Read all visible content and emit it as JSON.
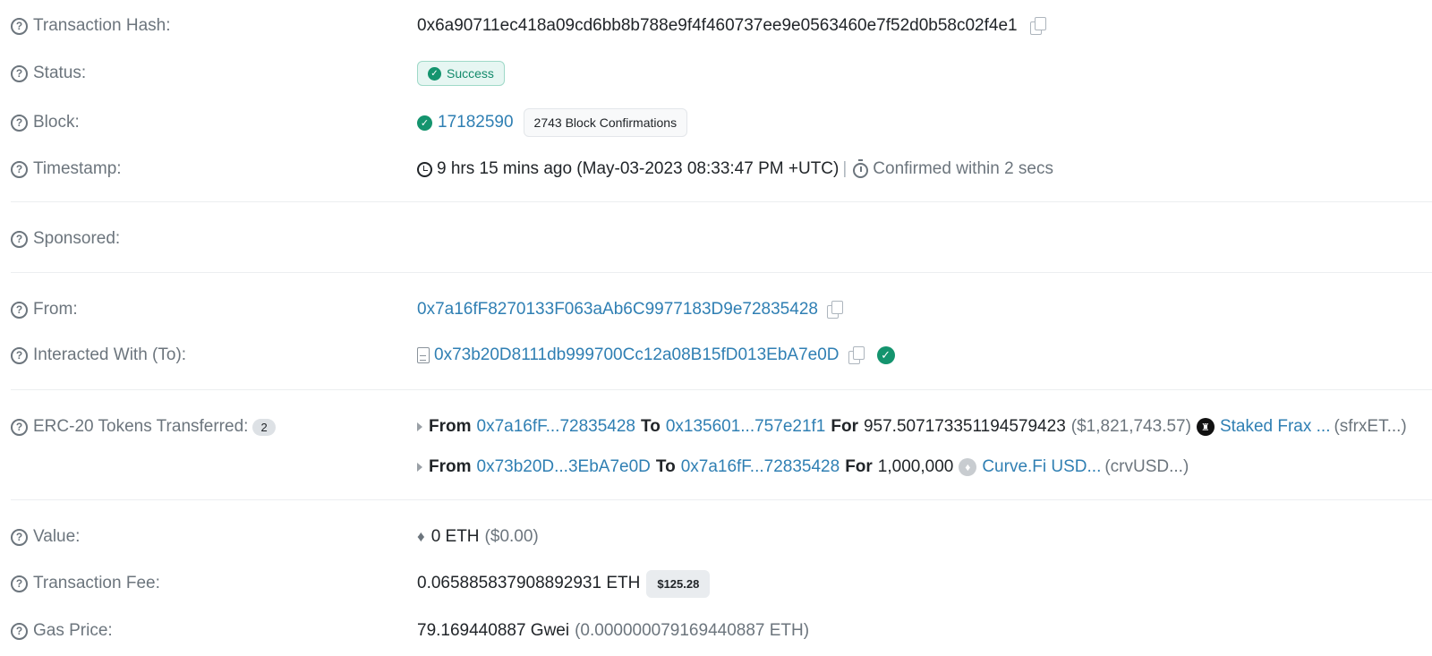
{
  "fields": {
    "tx_hash": {
      "label": "Transaction Hash:",
      "value": "0x6a90711ec418a09cd6bb8b788e9f4f460737ee9e0563460e7f52d0b58c02f4e1"
    },
    "status": {
      "label": "Status:",
      "value": "Success"
    },
    "block": {
      "label": "Block:",
      "number": "17182590",
      "confirmations": "2743 Block Confirmations"
    },
    "timestamp": {
      "label": "Timestamp:",
      "ago": "9 hrs 15 mins ago (May-03-2023 08:33:47 PM +UTC)",
      "separator": "|",
      "confirmed": "Confirmed within 2 secs"
    },
    "sponsored": {
      "label": "Sponsored:"
    },
    "from": {
      "label": "From:",
      "address": "0x7a16fF8270133F063aAb6C9977183D9e72835428"
    },
    "to": {
      "label": "Interacted With (To):",
      "address": "0x73b20D8111db999700Cc12a08B15fD013EbA7e0D"
    },
    "erc20": {
      "label": "ERC-20 Tokens Transferred:",
      "count": "2",
      "transfers": [
        {
          "from_word": "From",
          "from": "0x7a16fF...72835428",
          "to_word": "To",
          "to": "0x135601...757e21f1",
          "for_word": "For",
          "amount": "957.507173351194579423",
          "usd": "($1,821,743.57)",
          "token_name": "Staked Frax ...",
          "token_symbol": "(sfrxET...)",
          "token_icon": "sfrxeth-token-icon"
        },
        {
          "from_word": "From",
          "from": "0x73b20D...3EbA7e0D",
          "to_word": "To",
          "to": "0x7a16fF...72835428",
          "for_word": "For",
          "amount": "1,000,000",
          "usd": "",
          "token_name": "Curve.Fi USD...",
          "token_symbol": "(crvUSD...)",
          "token_icon": "crvusd-token-icon"
        }
      ]
    },
    "value": {
      "label": "Value:",
      "amount": "0 ETH",
      "usd": "($0.00)"
    },
    "fee": {
      "label": "Transaction Fee:",
      "amount": "0.065885837908892931 ETH",
      "usd": "$125.28"
    },
    "gas_price": {
      "label": "Gas Price:",
      "gwei": "79.169440887 Gwei",
      "eth": "(0.000000079169440887 ETH)"
    }
  },
  "icons": {
    "help": "?",
    "check": "✓",
    "eth": "♦",
    "token_sfrx": "♜",
    "token_eth": "♦"
  }
}
